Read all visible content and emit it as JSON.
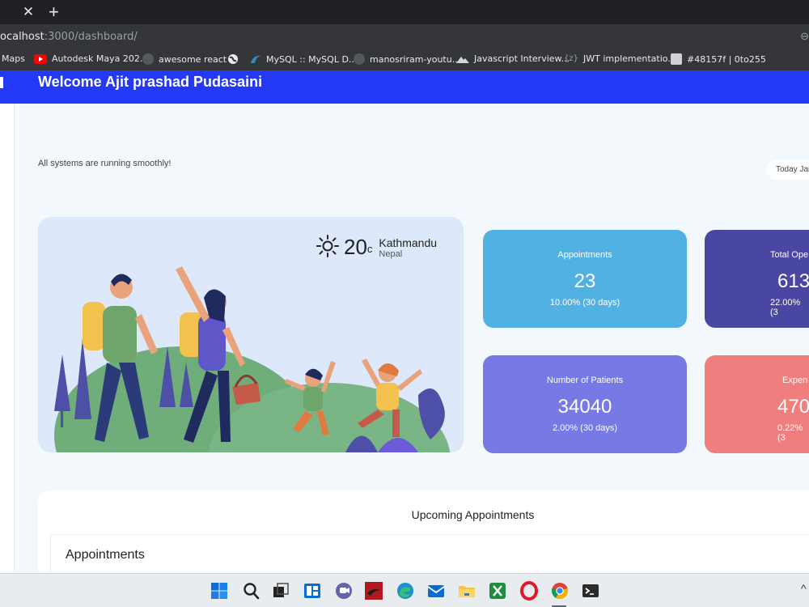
{
  "browser": {
    "tab_close_glyph": "✕",
    "new_tab_glyph": "+",
    "url_host": "ocalhost",
    "url_path": ":3000/dashboard/",
    "addr_right_glyph": "⊖"
  },
  "bookmarks": [
    {
      "label": "Maps",
      "icon": "maps-icon"
    },
    {
      "label": "Autodesk Maya 202...",
      "icon": "youtube-icon"
    },
    {
      "label": "awesome react",
      "icon": "github-icon"
    },
    {
      "label": "",
      "icon": "globe-icon"
    },
    {
      "label": "MySQL :: MySQL D...",
      "icon": "mysql-icon"
    },
    {
      "label": "manosriram-youtu...",
      "icon": "github-icon"
    },
    {
      "label": "Javascript Interview...",
      "icon": "mountain-icon"
    },
    {
      "label": "JWT implementatio...",
      "icon": "braces-icon"
    },
    {
      "label": "#48157f | 0to255",
      "icon": "swatch-icon"
    }
  ],
  "header": {
    "welcome": "Welcome Ajit prashad Pudasaini",
    "brand_color": "#2339f5"
  },
  "status_message": "All systems are running smoothly!",
  "date_pill": "Today Jan",
  "weather": {
    "temperature": "20",
    "unit": "c",
    "city": "Kathmandu",
    "country": "Nepal",
    "icon": "sun-icon"
  },
  "stats": [
    {
      "label": "Appointments",
      "value": "23",
      "delta": "10.00% (30 days)",
      "color": "#52b1e3"
    },
    {
      "label": "Total Ope",
      "value": "613",
      "delta": "22.00% (3",
      "color": "#4a47a3"
    },
    {
      "label": "Number of Patients",
      "value": "34040",
      "delta": "2.00% (30 days)",
      "color": "#7779e4"
    },
    {
      "label": "Expen",
      "value": "470",
      "delta": "0.22% (3",
      "color": "#f17e7e"
    }
  ],
  "upcoming": {
    "title": "Upcoming Appointments",
    "subtitle": "Appointments"
  },
  "taskbar": {
    "caret_glyph": "^",
    "icons": [
      "windows-start-icon",
      "search-icon",
      "task-view-icon",
      "widgets-icon",
      "teams-chat-icon",
      "app-red-icon",
      "edge-icon",
      "mail-icon",
      "file-explorer-icon",
      "xbox-icon",
      "opera-icon",
      "chrome-icon",
      "terminal-icon"
    ]
  }
}
